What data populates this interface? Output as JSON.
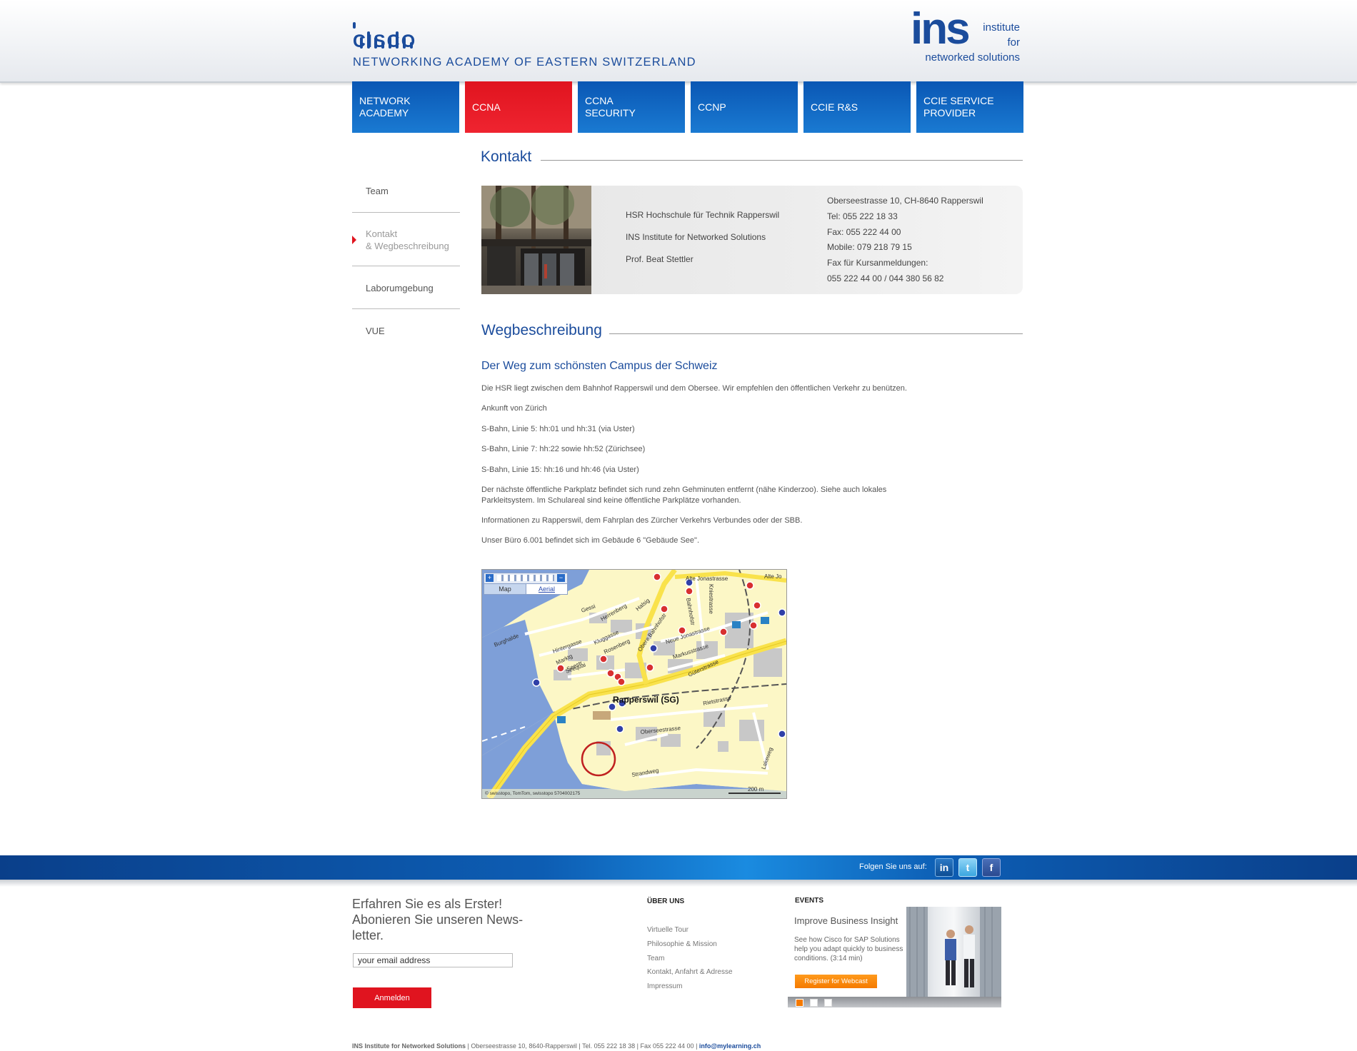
{
  "header": {
    "cisco_word": "CISCO",
    "academy_title": "NETWORKING ACADEMY OF EASTERN SWITZERLAND",
    "ins_word": "ins",
    "ins_line1": "institute",
    "ins_line2": "for",
    "ins_line3": "networked solutions"
  },
  "nav": [
    {
      "label": "NETWORK\nACADEMY"
    },
    {
      "label": "CCNA"
    },
    {
      "label": "CCNA\nSECURITY"
    },
    {
      "label": "CCNP"
    },
    {
      "label": "CCIE R&S"
    },
    {
      "label": "CCIE SERVICE\nPROVIDER"
    }
  ],
  "sidebar": [
    {
      "label": "Team"
    },
    {
      "label": "Kontakt\n& Wegbeschreibung"
    },
    {
      "label": "Laborumgebung"
    },
    {
      "label": "VUE"
    }
  ],
  "kontakt": {
    "heading": "Kontakt",
    "org1": "HSR Hochschule für Technik Rapperswil",
    "org2": "INS Institute for Networked Solutions",
    "person": "Prof. Beat Stettler",
    "address": "Oberseestrasse 10, CH-8640 Rapperswil",
    "tel": "Tel: 055 222 18 33",
    "fax": "Fax: 055 222 44 00",
    "mobile": "Mobile: 079 218 79 15",
    "fax_course_label": "Fax für Kursanmeldungen:",
    "fax_course": "055 222 44 00 / 044 380 56 82"
  },
  "weg": {
    "heading": "Wegbeschreibung",
    "subheading": "Der Weg zum schönsten Campus der Schweiz",
    "p1": "Die HSR liegt zwischen dem Bahnhof Rapperswil und dem Obersee. Wir empfehlen den öffentlichen Verkehr zu benützen.",
    "p2": "Ankunft von Zürich",
    "p3": "S-Bahn, Linie 5: hh:01 und hh:31 (via Uster)",
    "p4": "S-Bahn, Linie 7: hh:22 sowie hh:52 (Zürichsee)",
    "p5": "S-Bahn, Linie 15: hh:16 und hh:46 (via Uster)",
    "p6": "Der nächste öffentliche Parkplatz befindet sich rund zehn Gehminuten entfernt (nähe Kinderzoo). Siehe auch lokales Parkleitsystem. Im Schulareal sind keine öffentliche Parkplätze vorhanden.",
    "p7": "Informationen zu Rapperswil, dem Fahrplan des Zürcher Verkehrs Verbundes oder der SBB.",
    "p8": "Unser Büro 6.001 befindet sich im Gebäude 6 \"Gebäude See\"."
  },
  "map": {
    "tab_map": "Map",
    "tab_aerial": "Aerial",
    "place": "Rapperswil (SG)",
    "scale": "200 m",
    "copyright": "© swisstopo, TomTom, swisstopo 5704002175",
    "streets": [
      "Alte Jonastrasse",
      "Alte Jo",
      "Bahnhofstr",
      "Kniestrasse",
      "Neue Jonastrasse",
      "Markusstrasse",
      "Güterstrasse",
      "Rietstrasse",
      "Oberseestrasse",
      "Strandweg",
      "Lakeweg",
      "Seequai",
      "Hintergasse",
      "Kluggasse",
      "Herrenberg",
      "Halsig",
      "Gessi",
      "Burghalde",
      "Marktg",
      "Seestr",
      "Rosenberg",
      "Obere Bahnhofstr"
    ],
    "colors": {
      "land": "#fcf7c6",
      "water": "#7e9fd8",
      "road": "#f9e24b",
      "poi": "#d83030"
    }
  },
  "footer": {
    "follow_label": "Folgen Sie uns auf:",
    "social": [
      "in",
      "t",
      "f"
    ],
    "newsletter_heading": "Erfahren Sie es als Erster!\nAbonieren Sie unseren News-\nletter.",
    "newsletter_input_value": "your email address",
    "newsletter_button": "Anmelden",
    "about_title": "ÜBER UNS",
    "about_links": [
      "Virtuelle Tour",
      "Philosophie & Mission",
      "Team",
      "Kontakt, Anfahrt & Adresse",
      "Impressum"
    ],
    "events_title": "EVENTS",
    "event_title": "Improve Business Insight",
    "event_desc": "See how Cisco for SAP Solutions help you adapt quickly to business conditions. (3:14 min)",
    "event_button": "Register for Webcast",
    "bottom_org": "INS Institute for Networked Solutions",
    "bottom_text": " | Oberseestrasse 10, 8640-Rapperswil | Tel. 055 222 18 38 | Fax 055 222 44 00 | ",
    "bottom_email": "info@mylearning.ch"
  },
  "colors": {
    "brand_blue": "#1b4c9c",
    "accent_red": "#e0141f",
    "event_orange": "#f57a00"
  }
}
